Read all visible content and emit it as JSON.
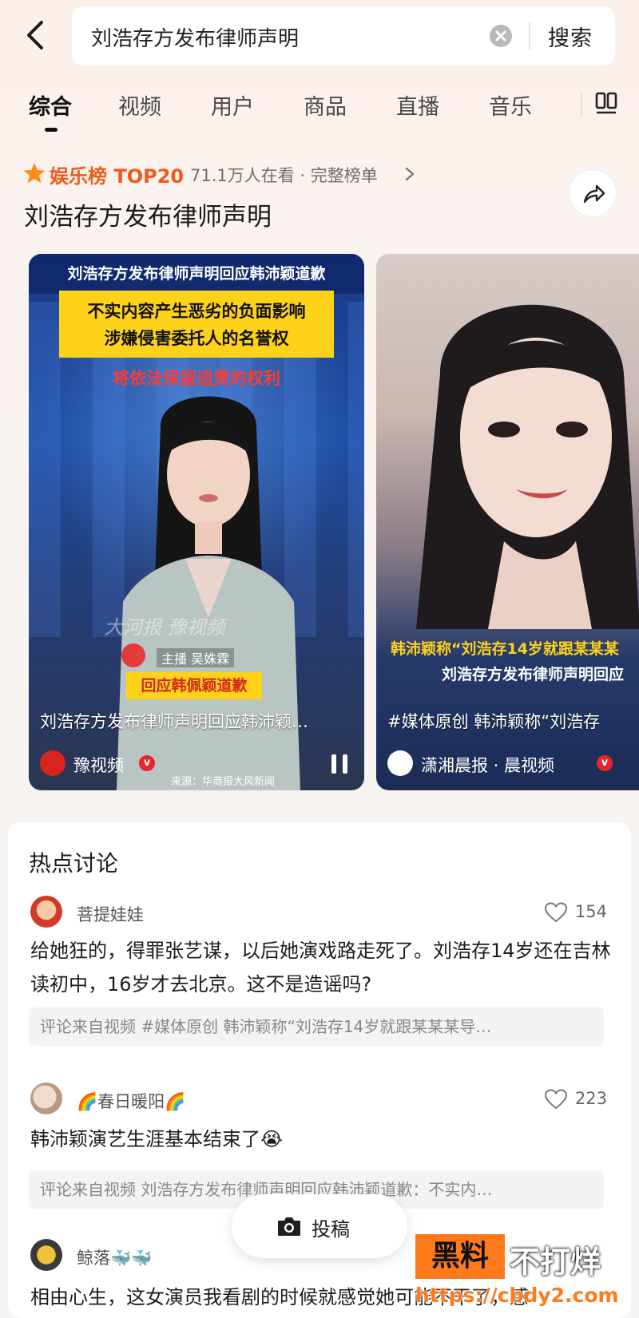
{
  "search": {
    "query": "刘浩存方发布律师声明",
    "submit_label": "搜索"
  },
  "tabs": [
    "综合",
    "视频",
    "用户",
    "商品",
    "直播",
    "音乐"
  ],
  "ranking": {
    "label": "娱乐榜 TOP20",
    "meta": "71.1万人在看 · 完整榜单",
    "title": "刘浩存方发布律师声明"
  },
  "videos": [
    {
      "top_line": "刘浩存方发布律师声明回应韩沛颖道歉",
      "yellow_line_1": "不实内容产生恶劣的负面影响",
      "yellow_line_2": "涉嫌侵害委托人的名誉权",
      "red_line": "将依法保留追责的权利",
      "watermark": "大河报 豫视频",
      "anchor_name": "主播 吴姝霖",
      "bottom_label": "回应韩佩颖道歉",
      "caption": "刘浩存方发布律师声明回应韩沛颖…",
      "source": "豫视频",
      "credit": "来源：华商报大风新闻"
    },
    {
      "headline_1": "韩沛颖称“刘浩存14岁就跟某某某",
      "headline_2": "刘浩存方发布律师声明回应",
      "caption": "#媒体原创 韩沛颖称“刘浩存",
      "source": "潇湘晨报 · 晨视频"
    }
  ],
  "discussion": {
    "title": "热点讨论",
    "comments": [
      {
        "user": "菩提娃娃",
        "likes": "154",
        "text": "给她狂的，得罪张艺谋，以后她演戏路走死了。刘浩存14岁还在吉林读初中，16岁才去北京。这不是造谣吗?",
        "source": "评论来自视频 #媒体原创 韩沛颖称“刘浩存14岁就跟某某某导…"
      },
      {
        "user": "🌈春日暖阳🌈",
        "likes": "223",
        "text": "韩沛颖演艺生涯基本结束了😭",
        "source": "评论来自视频 刘浩存方发布律师声明回应韩沛颖道歉：不实内…"
      },
      {
        "user": "鲸落🐳🐳",
        "likes": "",
        "text": "相由心生，这女演员我看剧的时候就感觉她可能不干了，感",
        "source": ""
      }
    ]
  },
  "post_button": {
    "label": "投稿"
  },
  "brand": {
    "box": "黑料",
    "rest": "不打烊",
    "url": "https://cbdy2.com"
  },
  "colors": {
    "accent": "#f05a1a",
    "verified": "#e8262a",
    "news_yellow": "#ffd21a"
  }
}
